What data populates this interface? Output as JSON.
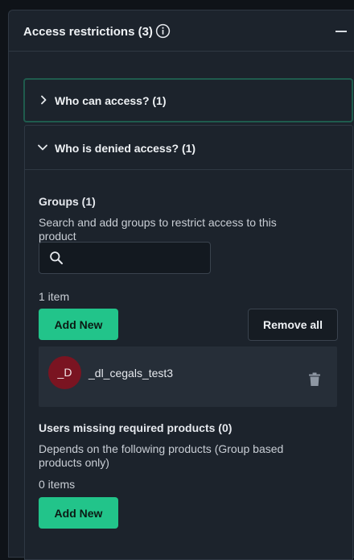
{
  "access_restrictions": {
    "title": "Access restrictions (3)",
    "info_icon": "info-circle-icon",
    "collapse_icon": "minus-icon"
  },
  "who_can_access": {
    "title": "Who can access? (1)",
    "expanded": false
  },
  "who_is_denied": {
    "title": "Who is denied access? (1)",
    "expanded": true,
    "groups": {
      "title": "Groups (1)",
      "description": "Search and add groups to restrict access to this product",
      "search_placeholder": "",
      "search_value": "",
      "count": "1 item",
      "add_label": "Add New",
      "remove_all_label": "Remove all",
      "items": [
        {
          "avatar": "_D",
          "name": "_dl_cegals_test3"
        }
      ]
    },
    "users_missing": {
      "title": "Users missing required products (0)",
      "description": "Depends on the following products (Group based products only)",
      "count": "0 items",
      "add_label": "Add New"
    }
  },
  "colors": {
    "accent": "#22c48a",
    "avatar": "#7a1421",
    "panel": "#1c232c",
    "background": "#0f1318",
    "focus_border": "#1f5b4d"
  }
}
